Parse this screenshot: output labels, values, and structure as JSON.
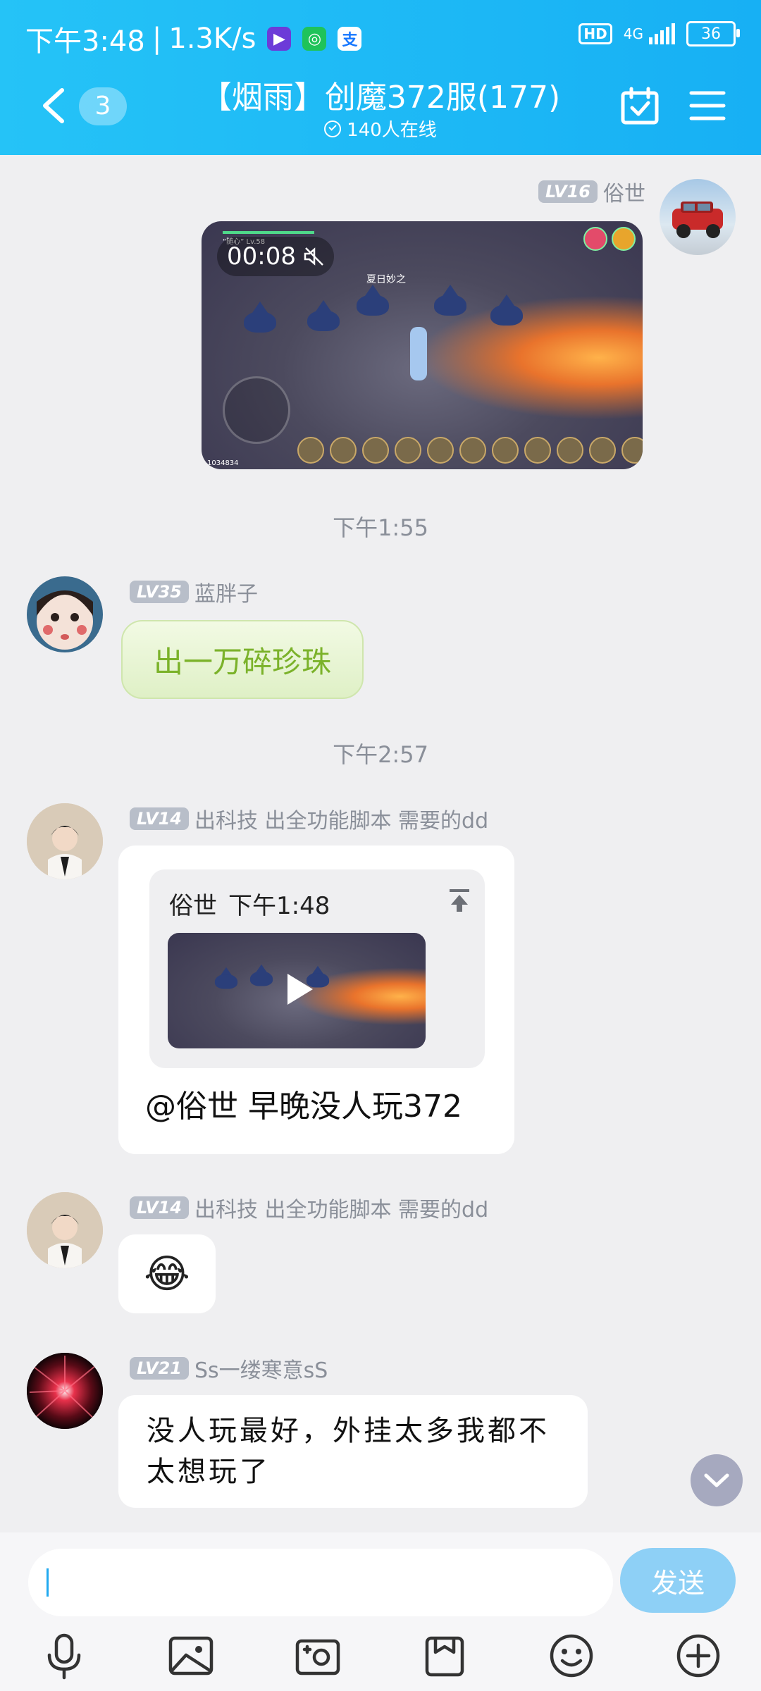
{
  "status_bar": {
    "time": "下午3:48",
    "speed": "1.3K/s",
    "hd": "HD",
    "network": "4G",
    "battery": "36"
  },
  "header": {
    "unread_count": "3",
    "title": "【烟雨】创魔372服(177)",
    "online": "140人在线"
  },
  "messages": {
    "m1": {
      "level": "LV16",
      "nickname": "俗世",
      "video_duration": "00:08",
      "video_overlay_title": "夏日妙之",
      "video_watermark": "1034834"
    },
    "time_1": "下午1:55",
    "m2": {
      "level": "LV35",
      "nickname": "蓝胖子",
      "text": "出一万碎珍珠"
    },
    "time_2": "下午2:57",
    "m3": {
      "level": "LV14",
      "nickname": "出科技 出全功能脚本 需要的dd",
      "quote_author": "俗世",
      "quote_time": "下午1:48",
      "text": "@俗世 早晚没人玩372"
    },
    "m4": {
      "level": "LV14",
      "nickname": "出科技 出全功能脚本 需要的dd",
      "emoji": "😂"
    },
    "m5": {
      "level": "LV21",
      "nickname": "Ss一缕寒意sS",
      "text": "没人玩最好，外挂太多我都不太想玩了"
    }
  },
  "input": {
    "value": "",
    "send_label": "发送"
  },
  "toolbar": [
    "microphone-icon",
    "image-icon",
    "camera-icon",
    "folder-icon",
    "emoji-icon",
    "plus-icon"
  ],
  "colors": {
    "header": "#1fb8f5",
    "send": "#8ed0f6",
    "green_bubble_text": "#7bb22a"
  }
}
